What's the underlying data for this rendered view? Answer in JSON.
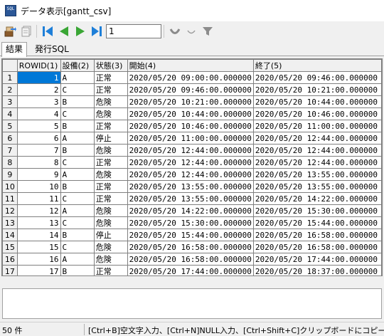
{
  "window": {
    "icon_text": "SQL",
    "title": "データ表示[gantt_csv]"
  },
  "toolbar": {
    "page_value": "1"
  },
  "tabs": [
    {
      "label": "結果"
    },
    {
      "label": "発行SQL"
    }
  ],
  "grid": {
    "columns": [
      "ROWID(1)",
      "設備(2)",
      "状態(3)",
      "開始(4)",
      "終了(5)"
    ],
    "rows": [
      {
        "num": "1",
        "rowid": "1",
        "equip": "A",
        "status": "正常",
        "start": "2020/05/20 09:00:00.000000",
        "end": "2020/05/20 09:46:00.000000"
      },
      {
        "num": "2",
        "rowid": "2",
        "equip": "C",
        "status": "正常",
        "start": "2020/05/20 09:46:00.000000",
        "end": "2020/05/20 10:21:00.000000"
      },
      {
        "num": "3",
        "rowid": "3",
        "equip": "B",
        "status": "危険",
        "start": "2020/05/20 10:21:00.000000",
        "end": "2020/05/20 10:44:00.000000"
      },
      {
        "num": "4",
        "rowid": "4",
        "equip": "C",
        "status": "危険",
        "start": "2020/05/20 10:44:00.000000",
        "end": "2020/05/20 10:46:00.000000"
      },
      {
        "num": "5",
        "rowid": "5",
        "equip": "B",
        "status": "正常",
        "start": "2020/05/20 10:46:00.000000",
        "end": "2020/05/20 11:00:00.000000"
      },
      {
        "num": "6",
        "rowid": "6",
        "equip": "A",
        "status": "停止",
        "start": "2020/05/20 11:00:00.000000",
        "end": "2020/05/20 12:44:00.000000"
      },
      {
        "num": "7",
        "rowid": "7",
        "equip": "B",
        "status": "危険",
        "start": "2020/05/20 12:44:00.000000",
        "end": "2020/05/20 12:44:00.000000"
      },
      {
        "num": "8",
        "rowid": "8",
        "equip": "C",
        "status": "正常",
        "start": "2020/05/20 12:44:00.000000",
        "end": "2020/05/20 12:44:00.000000"
      },
      {
        "num": "9",
        "rowid": "9",
        "equip": "A",
        "status": "危険",
        "start": "2020/05/20 12:44:00.000000",
        "end": "2020/05/20 13:55:00.000000"
      },
      {
        "num": "10",
        "rowid": "10",
        "equip": "B",
        "status": "正常",
        "start": "2020/05/20 13:55:00.000000",
        "end": "2020/05/20 13:55:00.000000"
      },
      {
        "num": "11",
        "rowid": "11",
        "equip": "C",
        "status": "正常",
        "start": "2020/05/20 13:55:00.000000",
        "end": "2020/05/20 14:22:00.000000"
      },
      {
        "num": "12",
        "rowid": "12",
        "equip": "A",
        "status": "危険",
        "start": "2020/05/20 14:22:00.000000",
        "end": "2020/05/20 15:30:00.000000"
      },
      {
        "num": "13",
        "rowid": "13",
        "equip": "C",
        "status": "危険",
        "start": "2020/05/20 15:30:00.000000",
        "end": "2020/05/20 15:44:00.000000"
      },
      {
        "num": "14",
        "rowid": "14",
        "equip": "B",
        "status": "停止",
        "start": "2020/05/20 15:44:00.000000",
        "end": "2020/05/20 16:58:00.000000"
      },
      {
        "num": "15",
        "rowid": "15",
        "equip": "C",
        "status": "危険",
        "start": "2020/05/20 16:58:00.000000",
        "end": "2020/05/20 16:58:00.000000"
      },
      {
        "num": "16",
        "rowid": "16",
        "equip": "A",
        "status": "危険",
        "start": "2020/05/20 16:58:00.000000",
        "end": "2020/05/20 17:44:00.000000"
      },
      {
        "num": "17",
        "rowid": "17",
        "equip": "B",
        "status": "正常",
        "start": "2020/05/20 17:44:00.000000",
        "end": "2020/05/20 18:37:00.000000"
      }
    ]
  },
  "statusbar": {
    "count": "50 件",
    "hint": "[Ctrl+B]空文字入力、[Ctrl+N]NULL入力、[Ctrl+Shift+C]クリップボードにコピー"
  },
  "icons": [
    "app-icon",
    "export-icon",
    "copy-icon",
    "first-page-icon",
    "prev-page-icon",
    "next-page-icon",
    "last-page-icon",
    "sort-desc-icon",
    "sort-asc-icon",
    "filter-icon"
  ],
  "colors": {
    "nav_blue": "#1e7fd8",
    "nav_green": "#3aa635",
    "selection": "#0078d7"
  }
}
